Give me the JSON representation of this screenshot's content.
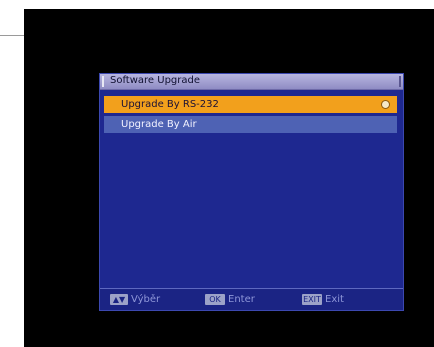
{
  "window": {
    "title": "Software Upgrade"
  },
  "menu": {
    "items": [
      {
        "label": "Upgrade By RS-232",
        "selected": true
      },
      {
        "label": "Upgrade By Air",
        "selected": false
      }
    ]
  },
  "footer": {
    "nav": {
      "key": "▲▼",
      "label": "Výběr"
    },
    "ok": {
      "key": "OK",
      "label": "Enter"
    },
    "exit": {
      "key": "EXIT",
      "label": "Exit"
    }
  },
  "colors": {
    "background": "#1e2890",
    "highlight": "#f2a01c",
    "item": "#4e62b4",
    "title_bar": "#a9a6d6"
  }
}
